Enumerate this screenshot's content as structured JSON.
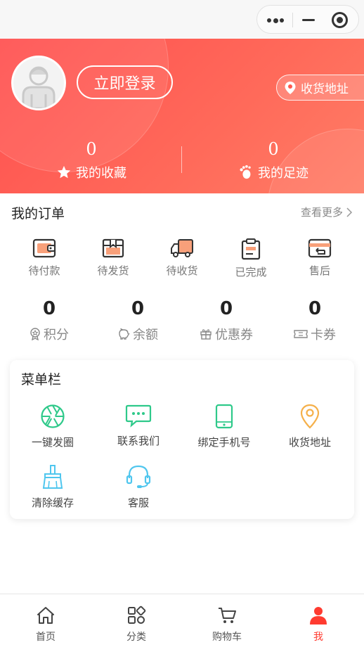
{
  "header": {
    "login_label": "立即登录",
    "address_label": "收货地址",
    "favorites": {
      "count": "0",
      "label": "我的收藏"
    },
    "footprints": {
      "count": "0",
      "label": "我的足迹"
    }
  },
  "orders": {
    "title": "我的订单",
    "more_label": "查看更多",
    "items": [
      {
        "label": "待付款",
        "icon": "wallet-icon"
      },
      {
        "label": "待发货",
        "icon": "box-icon"
      },
      {
        "label": "待收货",
        "icon": "truck-icon"
      },
      {
        "label": "已完成",
        "icon": "clipboard-icon"
      },
      {
        "label": "售后",
        "icon": "return-card-icon"
      }
    ]
  },
  "assets": [
    {
      "value": "0",
      "label": "积分",
      "icon": "medal-icon"
    },
    {
      "value": "0",
      "label": "余额",
      "icon": "pig-icon"
    },
    {
      "value": "0",
      "label": "优惠券",
      "icon": "gift-icon"
    },
    {
      "value": "0",
      "label": "卡券",
      "icon": "ticket-icon"
    }
  ],
  "menu": {
    "title": "菜单栏",
    "items": [
      {
        "label": "一键发圈",
        "icon": "aperture-icon"
      },
      {
        "label": "联系我们",
        "icon": "chat-icon"
      },
      {
        "label": "绑定手机号",
        "icon": "phone-icon"
      },
      {
        "label": "收货地址",
        "icon": "location-icon"
      },
      {
        "label": "清除缓存",
        "icon": "broom-icon"
      },
      {
        "label": "客服",
        "icon": "headset-icon"
      }
    ]
  },
  "tabbar": {
    "items": [
      {
        "label": "首页",
        "icon": "home-icon"
      },
      {
        "label": "分类",
        "icon": "category-icon"
      },
      {
        "label": "购物车",
        "icon": "cart-icon"
      },
      {
        "label": "我",
        "icon": "user-icon"
      }
    ],
    "active_index": 3
  },
  "colors": {
    "brand": "#ff4f4f",
    "active_tab": "#ff3b30",
    "order_icon_accent": "#f8a07a",
    "menu_green": "#2ec98a",
    "menu_orange": "#f5b04a",
    "menu_blue": "#4fc6ee"
  }
}
